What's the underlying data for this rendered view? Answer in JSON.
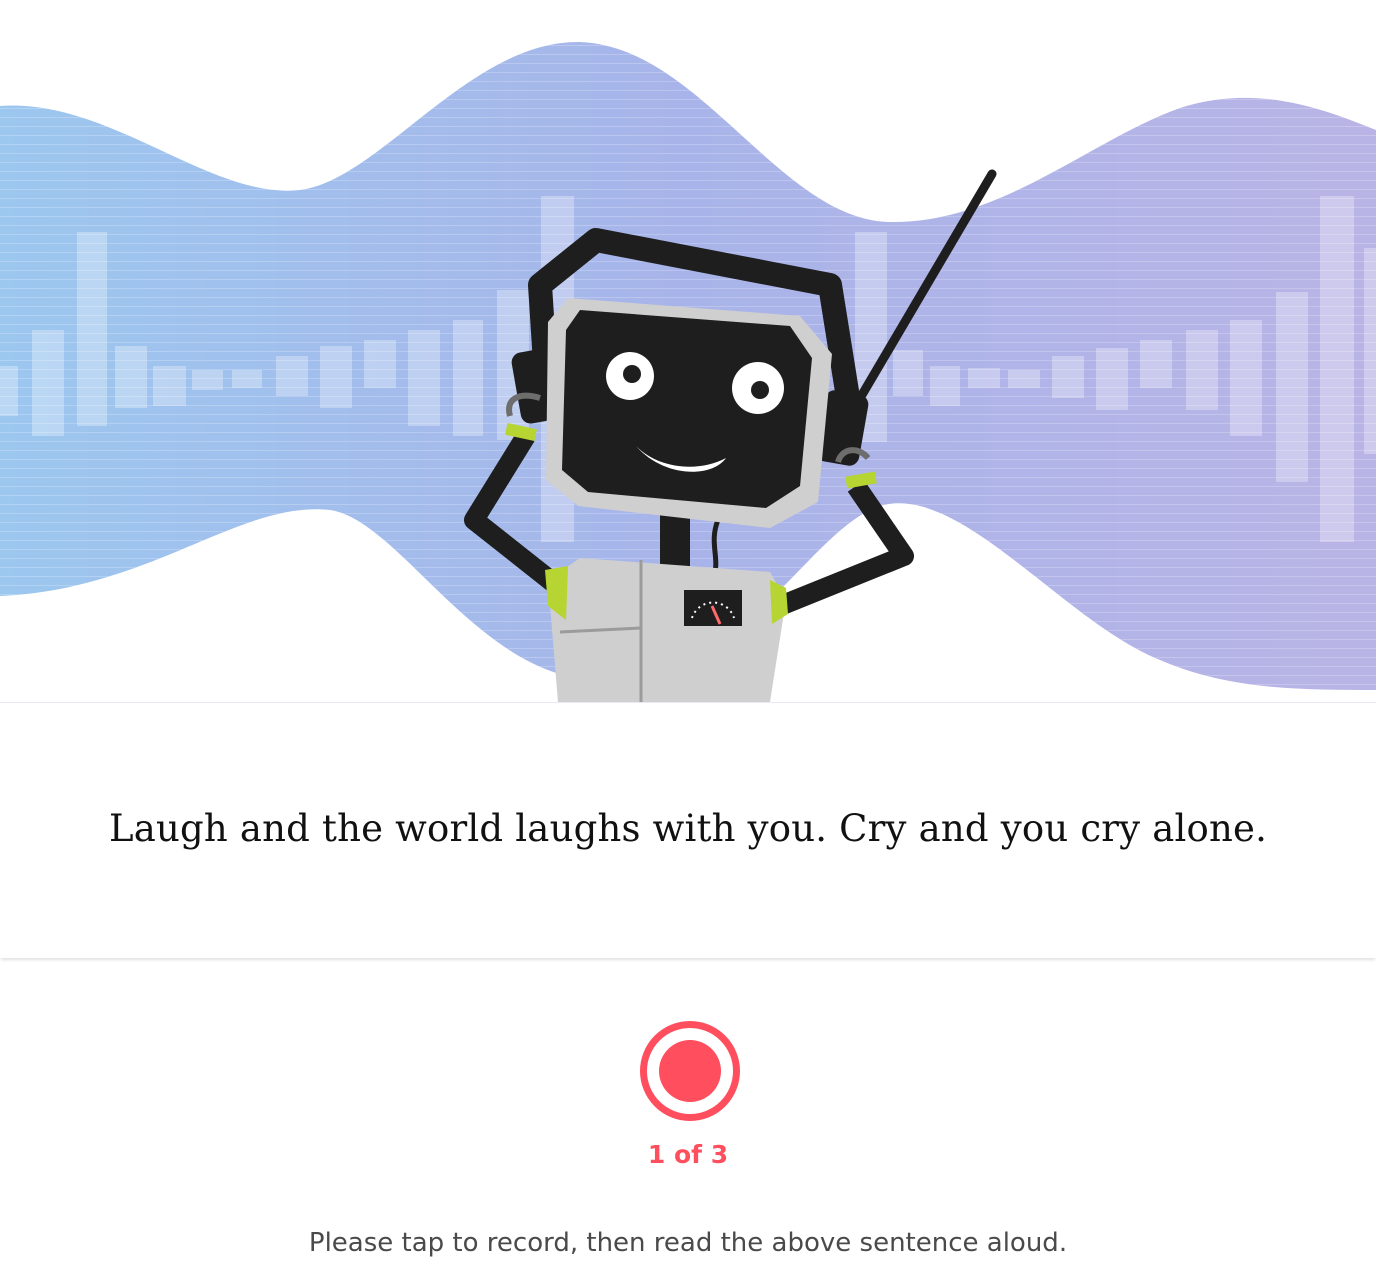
{
  "hero": {
    "illustration": "robot-with-headphones-and-antenna",
    "wave_colors": [
      "#9cc7ef",
      "#a9b6e8",
      "#b7b3e6"
    ]
  },
  "sentence": {
    "text": "Laugh and the world laughs with you. Cry and you cry alone."
  },
  "recorder": {
    "icon": "record-icon",
    "color": "#ff4f5e",
    "progress_text": "1 of 3",
    "instruction": "Please tap to record, then read the above sentence aloud."
  }
}
